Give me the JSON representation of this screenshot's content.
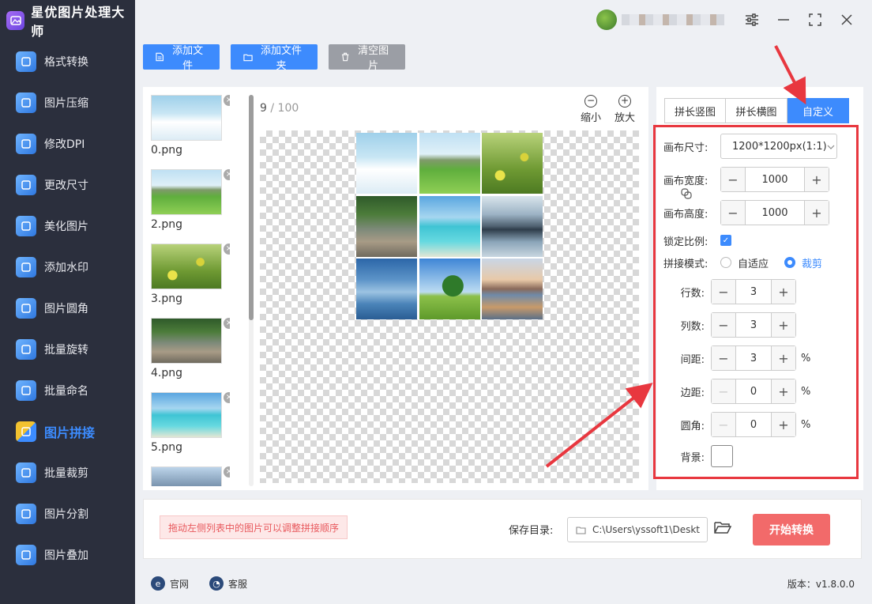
{
  "app": {
    "title": "星优图片处理大师"
  },
  "sidebar": {
    "items": [
      {
        "label": "格式转换",
        "icon": "image-convert-icon",
        "color": "#4a90e2"
      },
      {
        "label": "图片压缩",
        "icon": "compress-icon",
        "color": "#4a90e2"
      },
      {
        "label": "修改DPI",
        "icon": "dpi-icon",
        "color": "#4a90e2"
      },
      {
        "label": "更改尺寸",
        "icon": "resize-icon",
        "color": "#4a90e2"
      },
      {
        "label": "美化图片",
        "icon": "beautify-icon",
        "color": "#4a90e2"
      },
      {
        "label": "添加水印",
        "icon": "watermark-icon",
        "color": "#4a90e2"
      },
      {
        "label": "图片圆角",
        "icon": "round-corner-icon",
        "color": "#4a90e2"
      },
      {
        "label": "批量旋转",
        "icon": "rotate-icon",
        "color": "#4a90e2"
      },
      {
        "label": "批量命名",
        "icon": "rename-icon",
        "color": "#4a90e2"
      },
      {
        "label": "图片拼接",
        "icon": "stitch-icon",
        "color": "#e84c3d",
        "active": true
      },
      {
        "label": "批量裁剪",
        "icon": "crop-icon",
        "color": "#4a90e2"
      },
      {
        "label": "图片分割",
        "icon": "split-icon",
        "color": "#4a90e2"
      },
      {
        "label": "图片叠加",
        "icon": "layers-icon",
        "color": "#4a90e2"
      }
    ]
  },
  "toolbar": {
    "add_file": "添加文件",
    "add_folder": "添加文件夹",
    "clear": "清空图片"
  },
  "files": [
    {
      "name": "0.png",
      "thumb": "sky"
    },
    {
      "name": "2.png",
      "thumb": "field"
    },
    {
      "name": "3.png",
      "thumb": "flowers"
    },
    {
      "name": "4.png",
      "thumb": "river"
    },
    {
      "name": "5.png",
      "thumb": "sea"
    },
    {
      "name": "",
      "thumb": "mountain"
    }
  ],
  "preview": {
    "count": "9",
    "separator": " / ",
    "total": "100",
    "zoom_out": "缩小",
    "zoom_in": "放大",
    "grid_tiles": [
      "sky",
      "field",
      "flowers",
      "river",
      "sea",
      "lake",
      "mountains",
      "tree",
      "sunset"
    ]
  },
  "settings": {
    "tabs": [
      {
        "label": "拼长竖图",
        "active": false
      },
      {
        "label": "拼长横图",
        "active": false
      },
      {
        "label": "自定义",
        "active": true
      }
    ],
    "canvas_size_label": "画布尺寸:",
    "canvas_size_value": "1200*1200px(1:1)",
    "canvas_width_label": "画布宽度:",
    "canvas_width_value": "1000",
    "canvas_height_label": "画布高度:",
    "canvas_height_value": "1000",
    "lock_ratio_label": "锁定比例:",
    "lock_ratio_checked": true,
    "mode_label": "拼接模式:",
    "mode_options": [
      "自适应",
      "裁剪"
    ],
    "mode_selected": "裁剪",
    "rows_label": "行数:",
    "rows_value": "3",
    "cols_label": "列数:",
    "cols_value": "3",
    "gap_label": "间距:",
    "gap_value": "3",
    "margin_label": "边距:",
    "margin_value": "0",
    "radius_label": "圆角:",
    "radius_value": "0",
    "percent": "%",
    "bg_label": "背景:",
    "bg_color": "#ffffff"
  },
  "bottom": {
    "hint": "拖动左侧列表中的图片可以调整拼接顺序",
    "save_label": "保存目录:",
    "save_path": "C:\\Users\\yssoft1\\Deskt",
    "start": "开始转换"
  },
  "footer": {
    "website": "官网",
    "support": "客服",
    "version": "版本：v1.8.0.0"
  },
  "colors": {
    "accent": "#3d8bfd",
    "sidebar_bg": "#2b2f3d",
    "highlight_red": "#e8373f",
    "start_button": "#f26a6a"
  }
}
